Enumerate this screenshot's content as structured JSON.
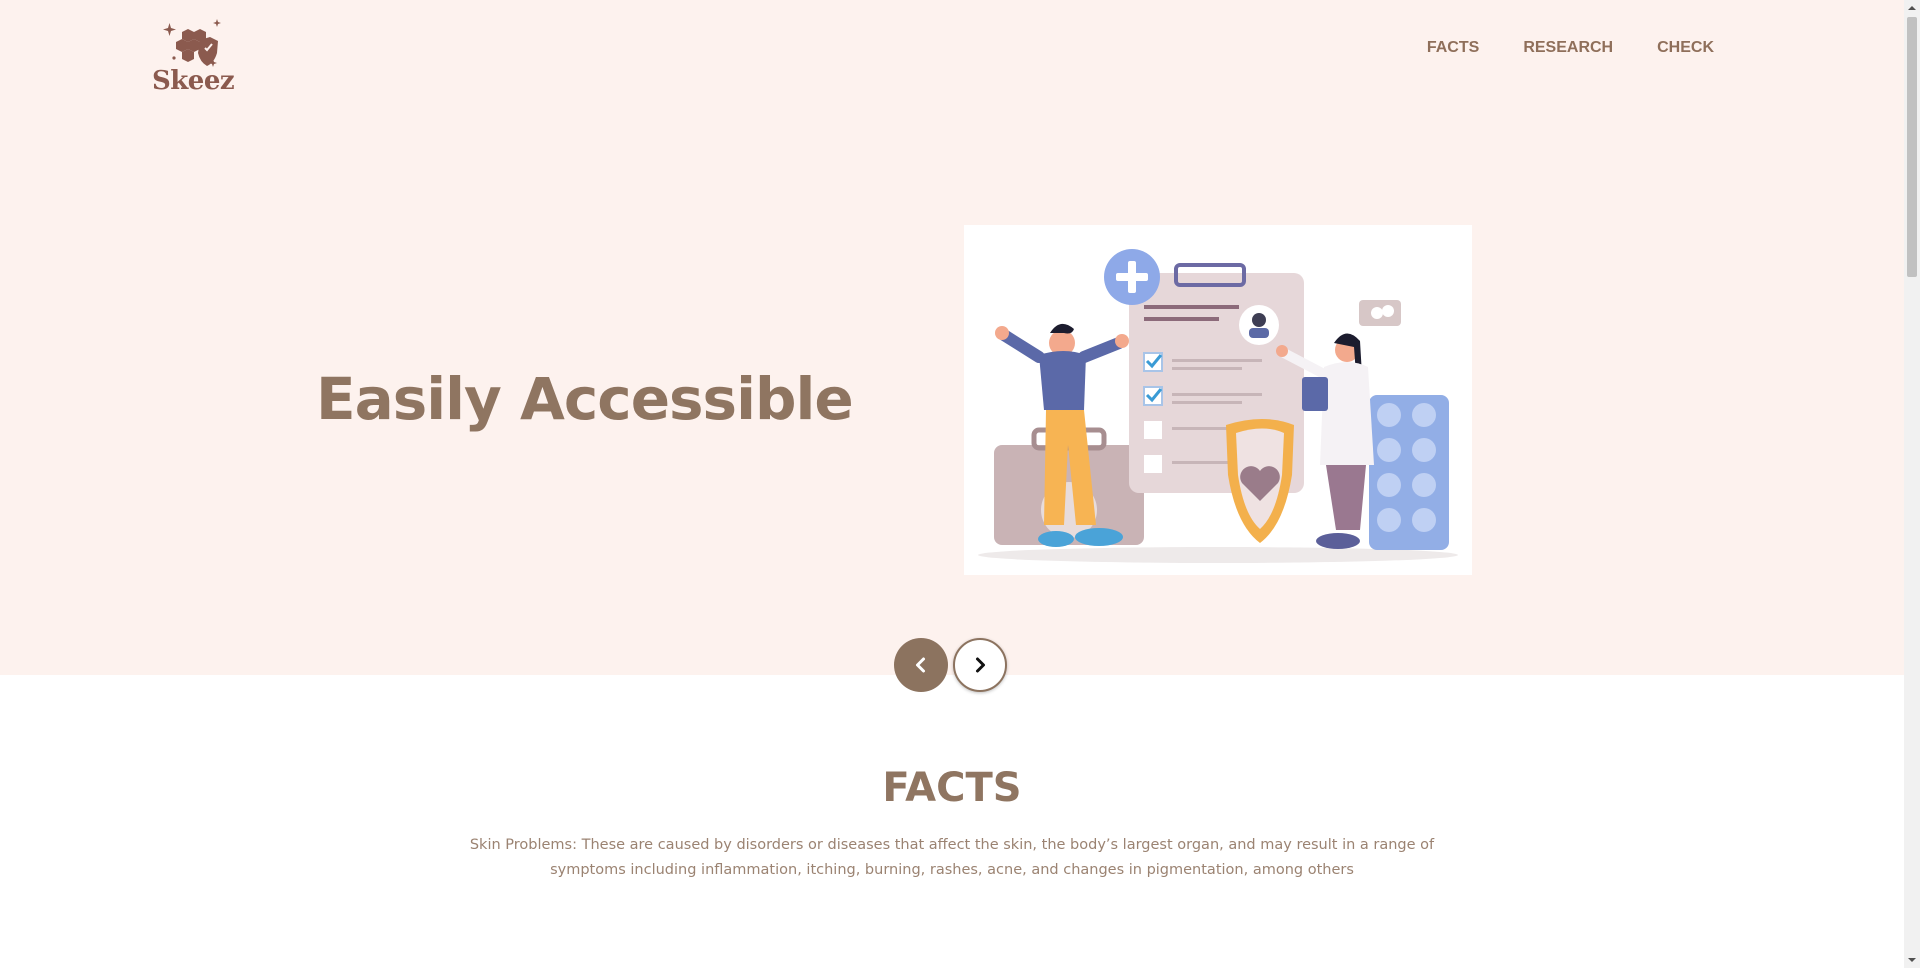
{
  "brand": {
    "name": "Skeez",
    "color": "#8b5a4e"
  },
  "nav": {
    "items": [
      "FACTS",
      "RESEARCH",
      "CHECK"
    ]
  },
  "hero": {
    "title": "Easily Accessible",
    "background": "#fdf2ee"
  },
  "carousel": {
    "prev_icon": "chevron-left-icon",
    "next_icon": "chevron-right-icon"
  },
  "facts": {
    "heading": "FACTS",
    "text": "Skin Problems: These are caused by disorders or diseases that affect the skin, the body’s largest organ, and may result in a range of symptoms including inflammation, itching, burning, rashes, acne, and changes in pigmentation, among others"
  },
  "colors": {
    "accent": "#8f7561",
    "button": "#8c735f"
  }
}
